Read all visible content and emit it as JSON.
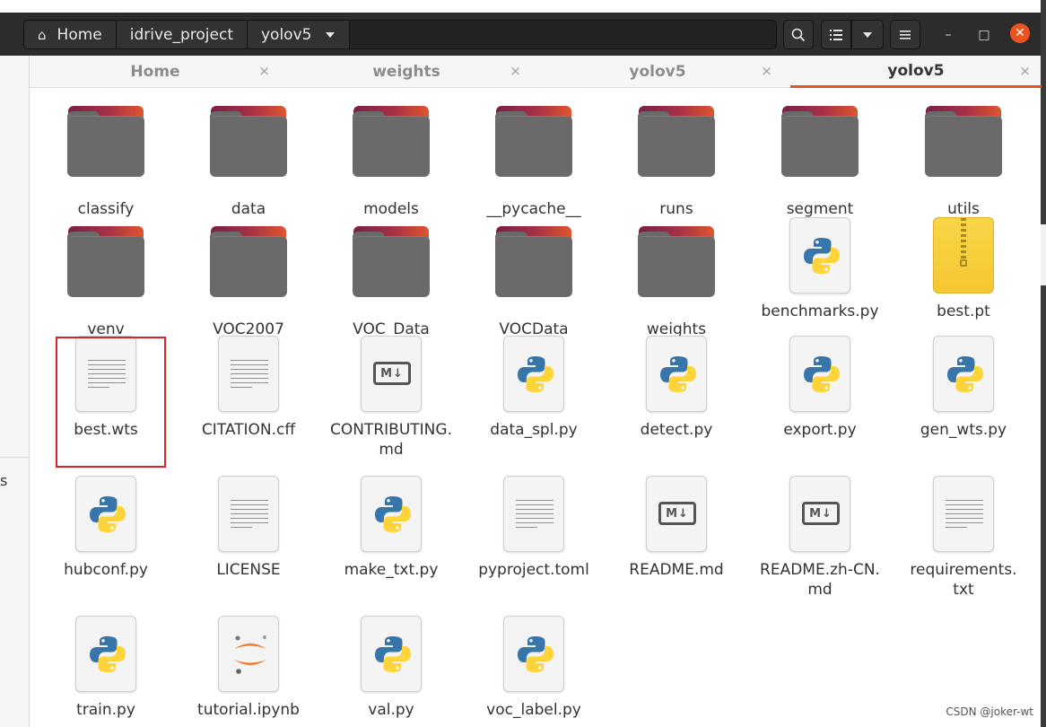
{
  "headerbar": {
    "path": [
      {
        "label": "Home",
        "icon": "home-icon"
      },
      {
        "label": "idrive_project"
      },
      {
        "label": "yolov5"
      }
    ],
    "buttons": {
      "search": "search-icon",
      "view": "list-view-icon",
      "view_menu": "chevron-down-icon",
      "menu": "hamburger-menu-icon",
      "minimize": "–",
      "maximize": "□",
      "close": "✕"
    }
  },
  "tabs": [
    {
      "label": "Home",
      "close": "×",
      "active": false
    },
    {
      "label": "weights",
      "close": "×",
      "active": false
    },
    {
      "label": "yolov5",
      "close": "×",
      "active": false
    },
    {
      "label": "yolov5",
      "close": "×",
      "active": true
    }
  ],
  "sidebar": {
    "partial_text": "s"
  },
  "files": [
    {
      "name": "classify",
      "type": "folder"
    },
    {
      "name": "data",
      "type": "folder"
    },
    {
      "name": "models",
      "type": "folder"
    },
    {
      "name": "__pycache__",
      "type": "folder"
    },
    {
      "name": "runs",
      "type": "folder"
    },
    {
      "name": "segment",
      "type": "folder"
    },
    {
      "name": "utils",
      "type": "folder"
    },
    {
      "name": "venv",
      "type": "folder"
    },
    {
      "name": "VOC2007",
      "type": "folder"
    },
    {
      "name": "VOC_Data",
      "type": "folder"
    },
    {
      "name": "VOCData",
      "type": "folder"
    },
    {
      "name": "weights",
      "type": "folder"
    },
    {
      "name": "benchmarks.py",
      "type": "python"
    },
    {
      "name": "best.pt",
      "type": "zip"
    },
    {
      "name": "best.wts",
      "type": "text",
      "highlighted": true
    },
    {
      "name": "CITATION.cff",
      "type": "text"
    },
    {
      "name": "CONTRIBUTING.\nmd",
      "type": "markdown"
    },
    {
      "name": "data_spl.py",
      "type": "python"
    },
    {
      "name": "detect.py",
      "type": "python"
    },
    {
      "name": "export.py",
      "type": "python"
    },
    {
      "name": "gen_wts.py",
      "type": "python"
    },
    {
      "name": "hubconf.py",
      "type": "python"
    },
    {
      "name": "LICENSE",
      "type": "text"
    },
    {
      "name": "make_txt.py",
      "type": "python"
    },
    {
      "name": "pyproject.toml",
      "type": "text"
    },
    {
      "name": "README.md",
      "type": "markdown"
    },
    {
      "name": "README.zh-CN.\nmd",
      "type": "markdown"
    },
    {
      "name": "requirements.\ntxt",
      "type": "text"
    },
    {
      "name": "train.py",
      "type": "python"
    },
    {
      "name": "tutorial.ipynb",
      "type": "jupyter"
    },
    {
      "name": "val.py",
      "type": "python"
    },
    {
      "name": "voc_label.py",
      "type": "python"
    }
  ],
  "md_badge": "M↓",
  "watermark": "CSDN @joker-wt",
  "colors": {
    "accent": "#e95420",
    "highlight": "#d9232b"
  }
}
